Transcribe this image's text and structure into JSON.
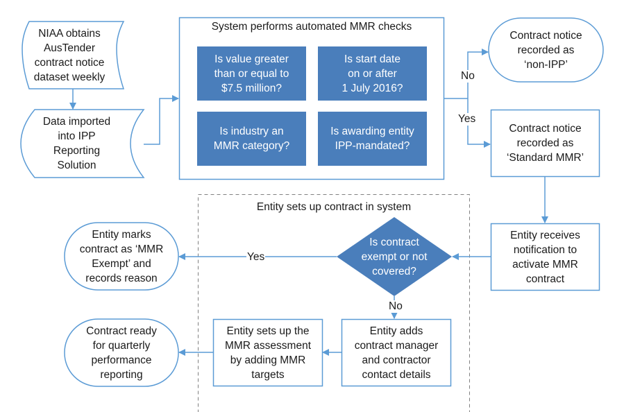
{
  "colors": {
    "stroke": "#5b9bd5",
    "fill_dark": "#4a7ebb",
    "dashed": "#808080",
    "text": "#1a1a1a"
  },
  "nodes": {
    "niaa_obtains": {
      "shape": "punched-tape",
      "text": "NIAA obtains\nAusTender\ncontract notice\ndataset weekly"
    },
    "data_imported": {
      "shape": "stored-data",
      "text": "Data imported\ninto IPP\nReporting\nSolution"
    },
    "automated_checks": {
      "title": "System performs automated MMR checks",
      "checks": [
        "Is value greater\nthan or equal to\n$7.5 million?",
        "Is start date\non or after\n1 July 2016?",
        "Is industry an\nMMR category?",
        "Is awarding entity\nIPP-mandated?"
      ]
    },
    "non_ipp": {
      "shape": "terminator",
      "text": "Contract notice\nrecorded as\n‘non-IPP’"
    },
    "standard_mmr": {
      "shape": "process",
      "text": "Contract notice\nrecorded as\n‘Standard MMR’"
    },
    "entity_receives": {
      "shape": "process",
      "text": "Entity receives\nnotification to\nactivate MMR\ncontract"
    },
    "setup_group": {
      "title": "Entity sets up contract in system"
    },
    "exempt_decision": {
      "shape": "decision",
      "text": "Is contract\nexempt or not\ncovered?"
    },
    "mmr_exempt": {
      "shape": "terminator",
      "text": "Entity marks\ncontract as ‘MMR\nExempt’ and\nrecords reason"
    },
    "adds_contacts": {
      "shape": "process",
      "text": "Entity adds\ncontract manager\nand contractor\ncontact details"
    },
    "sets_assessment": {
      "shape": "process",
      "text": "Entity sets up the\nMMR assessment\nby adding MMR\ntargets"
    },
    "contract_ready": {
      "shape": "terminator",
      "text": "Contract ready\nfor quarterly\nperformance\nreporting"
    }
  },
  "edge_labels": {
    "checks_no": "No",
    "checks_yes": "Yes",
    "exempt_yes": "Yes",
    "exempt_no": "No"
  }
}
